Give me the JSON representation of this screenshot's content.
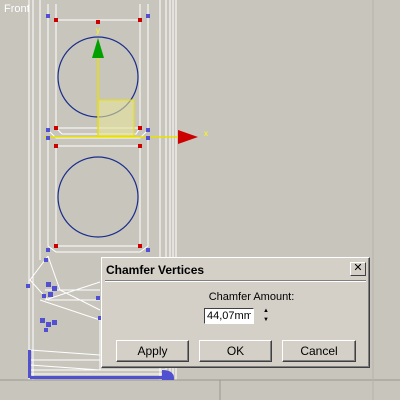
{
  "viewport": {
    "label": "Front",
    "colors": {
      "background": "#c8c5bd",
      "wire": "#ffffff",
      "vertex_red": "#cc0000",
      "vertex_blue": "#5050d0",
      "circle": "#1a2e8c",
      "gizmo_green": "#00a000",
      "gizmo_red": "#cc0000",
      "gizmo_yellow": "#e8e000"
    }
  },
  "dialog": {
    "title": "Chamfer Vertices",
    "close_glyph": "✕",
    "amount_label": "Chamfer Amount:",
    "amount_value": "44,07mm",
    "spinner_up_icon": "triangle-up",
    "spinner_down_icon": "triangle-down",
    "buttons": {
      "apply": "Apply",
      "ok": "OK",
      "cancel": "Cancel"
    }
  }
}
